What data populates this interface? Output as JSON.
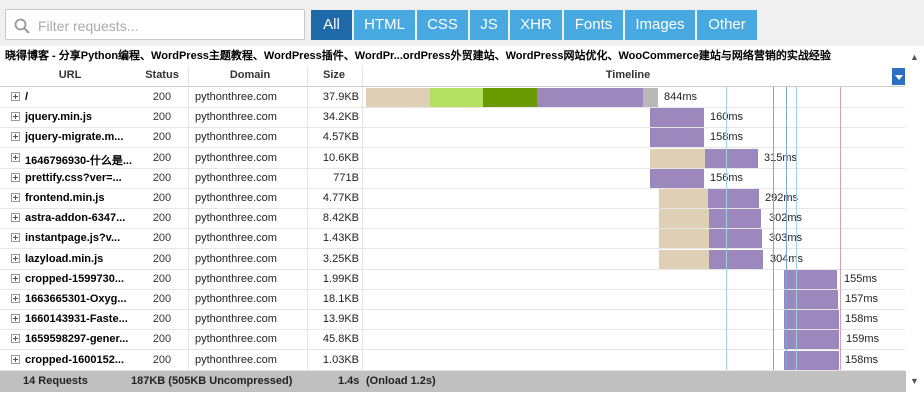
{
  "search": {
    "placeholder": "Filter requests..."
  },
  "filters": [
    {
      "label": "All",
      "active": true
    },
    {
      "label": "HTML",
      "active": false
    },
    {
      "label": "CSS",
      "active": false
    },
    {
      "label": "JS",
      "active": false
    },
    {
      "label": "XHR",
      "active": false
    },
    {
      "label": "Fonts",
      "active": false
    },
    {
      "label": "Images",
      "active": false
    },
    {
      "label": "Other",
      "active": false
    }
  ],
  "page_title": "晓得博客 - 分享Python编程、WordPress主题教程、WordPress插件、WordPr...ordPress外贸建站、WordPress网站优化、WooCommerce建站与网络营销的实战经验",
  "columns": {
    "url": "URL",
    "status": "Status",
    "domain": "Domain",
    "size": "Size",
    "timeline": "Timeline"
  },
  "colors": {
    "wait": "#dfcfb5",
    "dns": "#b5e061",
    "receive_dark": "#6a9a00",
    "download": "#9c88bc",
    "blocked": "#b8b8b8",
    "accent": "#1e6aa8",
    "filter_bg": "#48a8e0"
  },
  "requests": [
    {
      "url": "/",
      "status": "200",
      "domain": "pythonthree.com",
      "size": "37.9KB",
      "duration": "844ms"
    },
    {
      "url": "jquery.min.js",
      "status": "200",
      "domain": "pythonthree.com",
      "size": "34.2KB",
      "duration": "160ms"
    },
    {
      "url": "jquery-migrate.m...",
      "status": "200",
      "domain": "pythonthree.com",
      "size": "4.57KB",
      "duration": "158ms"
    },
    {
      "url": "1646796930-什么是...",
      "status": "200",
      "domain": "pythonthree.com",
      "size": "10.6KB",
      "duration": "315ms"
    },
    {
      "url": "prettify.css?ver=...",
      "status": "200",
      "domain": "pythonthree.com",
      "size": "771B",
      "duration": "156ms"
    },
    {
      "url": "frontend.min.js",
      "status": "200",
      "domain": "pythonthree.com",
      "size": "4.77KB",
      "duration": "292ms"
    },
    {
      "url": "astra-addon-6347...",
      "status": "200",
      "domain": "pythonthree.com",
      "size": "8.42KB",
      "duration": "302ms"
    },
    {
      "url": "instantpage.js?v...",
      "status": "200",
      "domain": "pythonthree.com",
      "size": "1.43KB",
      "duration": "303ms"
    },
    {
      "url": "lazyload.min.js",
      "status": "200",
      "domain": "pythonthree.com",
      "size": "3.25KB",
      "duration": "304ms"
    },
    {
      "url": "cropped-1599730...",
      "status": "200",
      "domain": "pythonthree.com",
      "size": "1.99KB",
      "duration": "155ms"
    },
    {
      "url": "1663665301-Oxyg...",
      "status": "200",
      "domain": "pythonthree.com",
      "size": "18.1KB",
      "duration": "157ms"
    },
    {
      "url": "1660143931-Faste...",
      "status": "200",
      "domain": "pythonthree.com",
      "size": "13.9KB",
      "duration": "158ms"
    },
    {
      "url": "1659598297-gener...",
      "status": "200",
      "domain": "pythonthree.com",
      "size": "45.8KB",
      "duration": "159ms"
    },
    {
      "url": "cropped-1600152...",
      "status": "200",
      "domain": "pythonthree.com",
      "size": "1.03KB",
      "duration": "158ms"
    }
  ],
  "footer": {
    "requests": "14 Requests",
    "size": "187KB  (505KB Uncompressed)",
    "time": "1.4s",
    "onload": "(Onload 1.2s)"
  }
}
